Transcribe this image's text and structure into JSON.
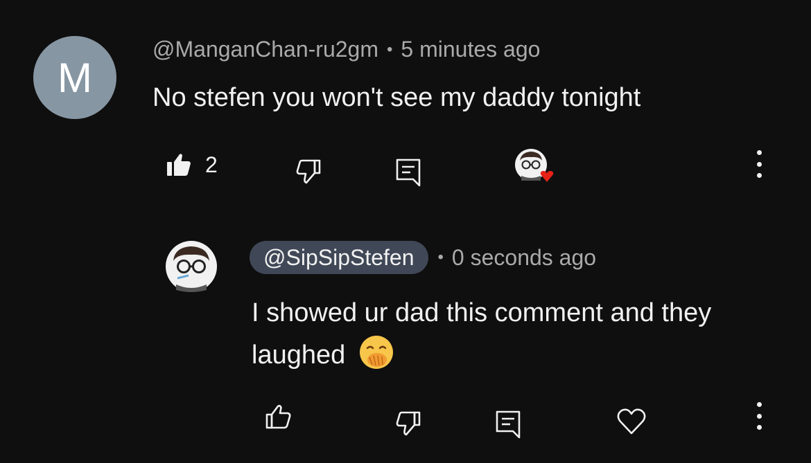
{
  "comment": {
    "avatar_letter": "M",
    "author": "@ManganChan-ru2gm",
    "separator": "•",
    "time": "5 minutes ago",
    "text": "No stefen you won't see my daddy tonight",
    "like_count": "2",
    "icons": [
      "thumbs-up-filled-icon",
      "thumbs-down-icon",
      "reply-icon",
      "creator-heart-badge",
      "more-vert-icon"
    ]
  },
  "reply": {
    "author": "@SipSipStefen",
    "separator": "•",
    "time": "0 seconds ago",
    "text": "I showed ur dad this comment and they laughed",
    "emoji": "face-with-hand-over-mouth",
    "icons": [
      "thumbs-up-icon",
      "thumbs-down-icon",
      "reply-icon",
      "heart-icon",
      "more-vert-icon"
    ]
  },
  "colors": {
    "background": "#0f0f0f",
    "text": "#f1f1f1",
    "secondary_text": "#aaaaaa",
    "avatar_letter_bg": "#8796a3",
    "author_chip_bg": "#404857",
    "heart_red": "#e62117"
  }
}
